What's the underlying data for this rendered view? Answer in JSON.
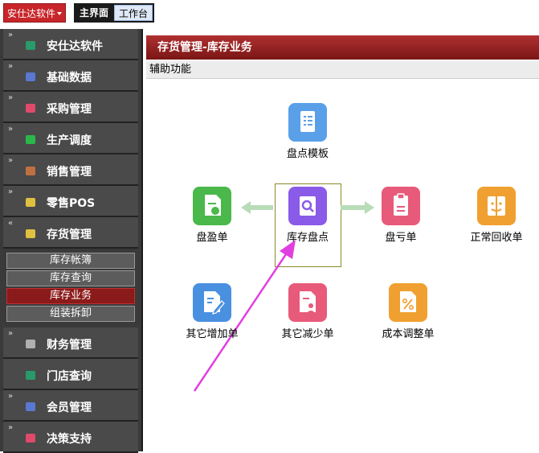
{
  "topbar": {
    "app_menu_label": "安仕达软件",
    "tabs": [
      {
        "label": "主界面",
        "active": true
      },
      {
        "label": "工作台",
        "active": false
      }
    ]
  },
  "sidebar": {
    "items": [
      {
        "label": "安仕达软件",
        "icon_color": "#2a9a6a"
      },
      {
        "label": "基础数据",
        "icon_color": "#5a78d0"
      },
      {
        "label": "采购管理",
        "icon_color": "#e04a6a"
      },
      {
        "label": "生产调度",
        "icon_color": "#2ab84a"
      },
      {
        "label": "销售管理",
        "icon_color": "#c07040"
      },
      {
        "label": "零售POS",
        "icon_color": "#e0c040"
      },
      {
        "label": "存货管理",
        "icon_color": "#e0c040",
        "expanded": true
      }
    ],
    "sub_items": [
      {
        "label": "库存帐簿",
        "active": false
      },
      {
        "label": "库存查询",
        "active": false
      },
      {
        "label": "库存业务",
        "active": true
      },
      {
        "label": "组装拆卸",
        "active": false
      }
    ],
    "items_after": [
      {
        "label": "财务管理",
        "icon_color": "#b0b0b0"
      },
      {
        "label": "门店查询",
        "icon_color": "#2a9a6a"
      },
      {
        "label": "会员管理",
        "icon_color": "#5a78d0"
      },
      {
        "label": "决策支持",
        "icon_color": "#e04a6a"
      }
    ]
  },
  "main": {
    "title": "存货管理-库存业务",
    "subtitle": "辅助功能",
    "functions": {
      "template": {
        "label": "盘点模板",
        "color": "#5aa0e8",
        "icon": "document-list-icon"
      },
      "surplus": {
        "label": "盘盈单",
        "color": "#4ab84a",
        "icon": "surplus-doc-icon"
      },
      "stocktake": {
        "label": "库存盘点",
        "color": "#8a5ae8",
        "icon": "search-doc-icon"
      },
      "loss": {
        "label": "盘亏单",
        "color": "#e85a7a",
        "icon": "clipboard-icon"
      },
      "recycle": {
        "label": "正常回收单",
        "color": "#f0a030",
        "icon": "face-doc-icon"
      },
      "other_add": {
        "label": "其它增加单",
        "color": "#4a90e0",
        "icon": "edit-doc-icon"
      },
      "other_reduce": {
        "label": "其它减少单",
        "color": "#e85a7a",
        "icon": "person-doc-icon"
      },
      "cost_adjust": {
        "label": "成本调整单",
        "color": "#f0a030",
        "icon": "percent-doc-icon"
      }
    }
  }
}
